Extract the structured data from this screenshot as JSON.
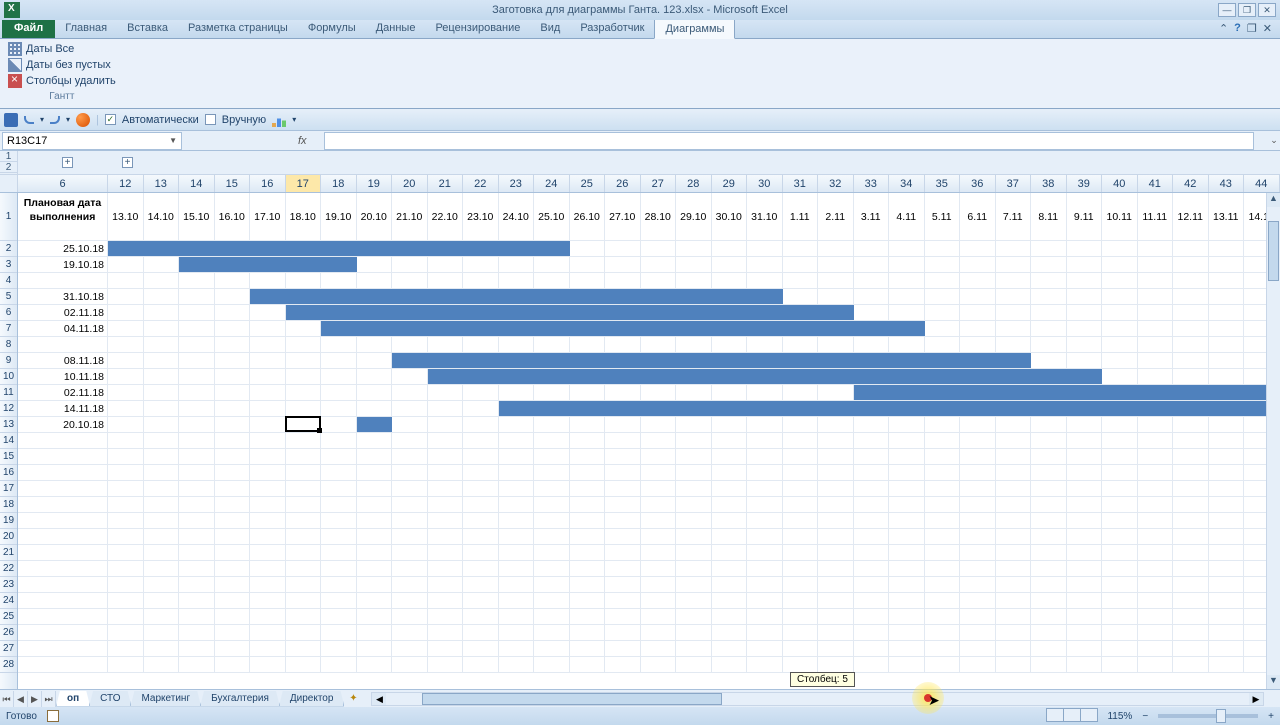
{
  "title": "Заготовка для диаграммы Ганта. 123.xlsx - Microsoft Excel",
  "ribbon": {
    "file": "Файл",
    "tabs": [
      "Главная",
      "Вставка",
      "Разметка страницы",
      "Формулы",
      "Данные",
      "Рецензирование",
      "Вид",
      "Разработчик",
      "Диаграммы"
    ],
    "active_tab": "Диаграммы",
    "group": {
      "dates_all": "Даты Все",
      "dates_noempty": "Даты без пустых",
      "cols_delete": "Столбцы удалить",
      "label": "Гантт"
    }
  },
  "qat": {
    "auto": "Автоматически",
    "manual": "Вручную"
  },
  "name_box": "R13C17",
  "fx": "fx",
  "outline_levels": [
    "1",
    "2"
  ],
  "col_headers": {
    "first": "6",
    "nums": [
      "12",
      "13",
      "14",
      "15",
      "16",
      "17",
      "18",
      "19",
      "20",
      "21",
      "22",
      "23",
      "24",
      "25",
      "26",
      "27",
      "28",
      "29",
      "30",
      "31",
      "32",
      "33",
      "34",
      "35",
      "36",
      "37",
      "38",
      "39",
      "40",
      "41",
      "42",
      "43",
      "44"
    ]
  },
  "highlight_col": "17",
  "header_row": {
    "plan_date": "Плановая дата выполнения",
    "dates": [
      "13.10",
      "14.10",
      "15.10",
      "16.10",
      "17.10",
      "18.10",
      "19.10",
      "20.10",
      "21.10",
      "22.10",
      "23.10",
      "24.10",
      "25.10",
      "26.10",
      "27.10",
      "28.10",
      "29.10",
      "30.10",
      "31.10",
      "1.11",
      "2.11",
      "3.11",
      "4.11",
      "5.11",
      "6.11",
      "7.11",
      "8.11",
      "9.11",
      "10.11",
      "11.11",
      "12.11",
      "13.11",
      "14.11"
    ]
  },
  "rows": [
    {
      "n": "2",
      "date": "25.10.18",
      "bar": {
        "start": 0,
        "len": 13
      }
    },
    {
      "n": "3",
      "date": "19.10.18",
      "bar": {
        "start": 2,
        "len": 5
      }
    },
    {
      "n": "4",
      "date": "",
      "bar": null
    },
    {
      "n": "5",
      "date": "31.10.18",
      "bar": {
        "start": 4,
        "len": 15
      }
    },
    {
      "n": "6",
      "date": "02.11.18",
      "bar": {
        "start": 5,
        "len": 16
      }
    },
    {
      "n": "7",
      "date": "04.11.18",
      "bar": {
        "start": 6,
        "len": 17
      }
    },
    {
      "n": "8",
      "date": "",
      "bar": null
    },
    {
      "n": "9",
      "date": "08.11.18",
      "bar": {
        "start": 8,
        "len": 18
      }
    },
    {
      "n": "10",
      "date": "10.11.18",
      "bar": {
        "start": 9,
        "len": 19
      }
    },
    {
      "n": "11",
      "date": "02.11.18",
      "bar": {
        "start": 21,
        "len": 12
      }
    },
    {
      "n": "12",
      "date": "14.11.18",
      "bar": {
        "start": 11,
        "len": 22
      }
    },
    {
      "n": "13",
      "date": "20.10.18",
      "bar": {
        "start": 7,
        "len": 1
      }
    }
  ],
  "empty_rows": [
    "14",
    "15",
    "16",
    "17",
    "18",
    "19",
    "20",
    "21",
    "22",
    "23",
    "24",
    "25",
    "26",
    "27",
    "28"
  ],
  "selected_cell": {
    "row": 13,
    "col": 5
  },
  "sheet_tabs": [
    "оп",
    "СТО",
    "Маркетинг",
    "Бухгалтерия",
    "Директор"
  ],
  "active_sheet": "оп",
  "scroll_tooltip": "Столбец: 5",
  "status": {
    "ready": "Готово",
    "zoom": "115%"
  }
}
